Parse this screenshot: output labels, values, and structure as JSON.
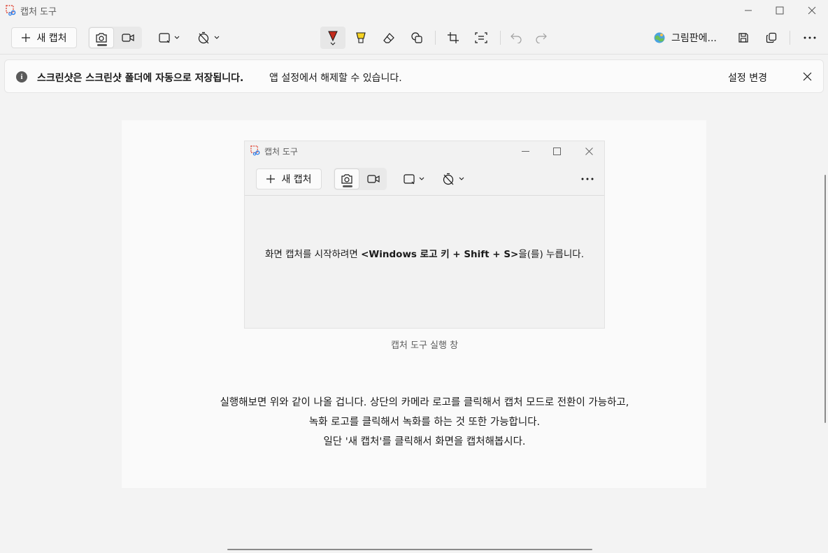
{
  "window": {
    "title": "캡처 도구"
  },
  "toolbar": {
    "new_capture_label": "새 캡처",
    "paint_label": "그림판에...",
    "icons": [
      "camera-icon",
      "video-icon",
      "rectangle-mode-icon",
      "timer-icon",
      "ballpoint-pen-icon",
      "highlighter-icon",
      "eraser-icon",
      "shapes-icon",
      "crop-icon",
      "text-actions-icon",
      "undo-icon",
      "redo-icon",
      "paint-icon",
      "save-icon",
      "copy-icon",
      "more-icon"
    ],
    "colors": {
      "pen": "#c42b1c",
      "highlighter": "#f5d223"
    }
  },
  "infobar": {
    "bold_text": "스크린샷은 스크린샷 폴더에 자동으로 저장됩니다.",
    "normal_text": "앱 설정에서 해제할 수 있습니다.",
    "action_label": "설정 변경"
  },
  "capture": {
    "inner_window_title": "캡처 도구",
    "inner_new_capture_label": "새 캡처",
    "inner_instruction_prefix": "화면 캡처를 시작하려면 ",
    "inner_instruction_bold": "<Windows 로고 키 + Shift + S>",
    "inner_instruction_suffix": "을(를) 누릅니다.",
    "caption": "캡처 도구 실행 창",
    "description_lines": [
      "실행해보면 위와 같이 나올 겁니다. 상단의 카메라 로고를 클릭해서 캡처 모드로 전환이 가능하고,",
      "녹화 로고를 클릭해서 녹화를 하는 것 또한 가능합니다.",
      "일단 '새 캡처'를 클릭해서 화면을 캡처해봅시다."
    ]
  }
}
